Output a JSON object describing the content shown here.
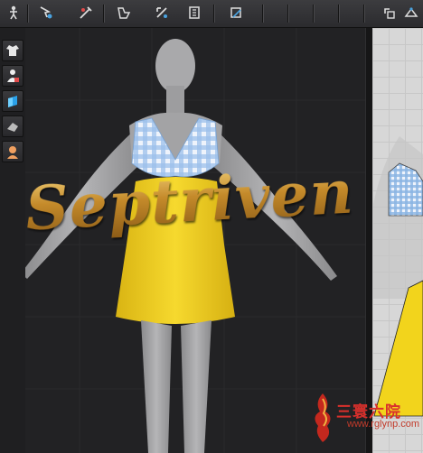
{
  "toolbar": {
    "tools": [
      {
        "icon": "select-mesh-icon"
      },
      {
        "icon": "move-pin-icon"
      },
      {
        "icon": "edit-fold-icon"
      },
      {
        "icon": "fold-arrangement-icon"
      },
      {
        "icon": "tack-icon"
      },
      {
        "icon": "zipper-icon"
      },
      {
        "icon": "texture-edit-icon"
      },
      {
        "icon": "pattern-rotate-icon"
      },
      {
        "icon": "pattern-transform-icon"
      }
    ]
  },
  "sidebar": {
    "buttons": [
      {
        "icon": "garment-display-icon"
      },
      {
        "icon": "avatar-display-icon"
      },
      {
        "icon": "texture-display-icon"
      },
      {
        "icon": "surface-display-icon"
      },
      {
        "icon": "skin-display-icon"
      }
    ]
  },
  "watermark": {
    "text": "Septriven"
  },
  "stamp": {
    "cjk": "三寰六院",
    "url": "www.rglynp.com"
  },
  "colors": {
    "dress_yellow": "#f2d22b",
    "gingham_blue": "#8fb8e6",
    "avatar_gray": "#a7a7a9",
    "viewport_bg": "#222224",
    "pattern_bg": "#d7d7d7"
  }
}
